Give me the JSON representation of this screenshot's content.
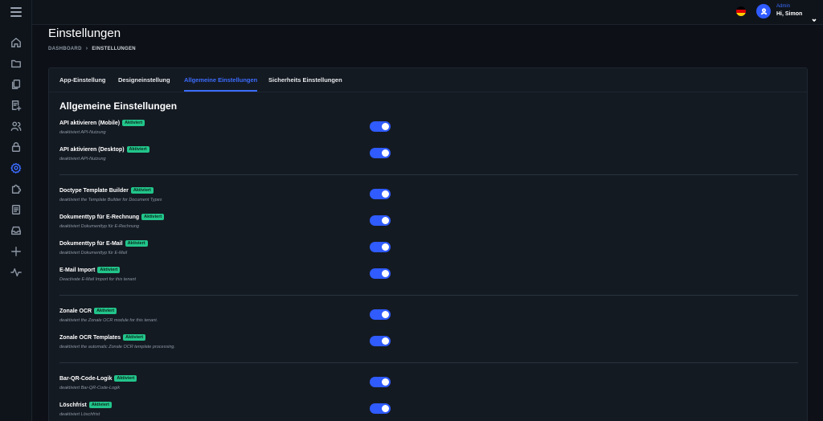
{
  "header": {
    "flag": "germany-flag",
    "user_role": "Admin",
    "user_greeting": "Hi, Simon"
  },
  "sidebar": {
    "items": [
      {
        "icon": "home-icon"
      },
      {
        "icon": "folder-icon"
      },
      {
        "icon": "documents-icon"
      },
      {
        "icon": "document-add-icon"
      },
      {
        "icon": "users-icon"
      },
      {
        "icon": "lock-icon"
      },
      {
        "icon": "gear-icon",
        "active": true
      },
      {
        "icon": "puzzle-icon"
      },
      {
        "icon": "report-icon"
      },
      {
        "icon": "inbox-icon"
      },
      {
        "icon": "plus-icon"
      },
      {
        "icon": "activity-icon"
      }
    ]
  },
  "page": {
    "title": "Einstellungen",
    "breadcrumb": {
      "root": "DASHBOARD",
      "separator": "›",
      "current": "EINSTELLUNGEN"
    }
  },
  "tabs": [
    {
      "label": "App-Einstellung"
    },
    {
      "label": "Designeinstellung"
    },
    {
      "label": "Allgemeine Einstellungen",
      "active": true
    },
    {
      "label": "Sicherheits Einstellungen"
    }
  ],
  "section": {
    "title": "Allgemeine Einstellungen"
  },
  "badge_label": "Aktiviert",
  "settings": [
    {
      "label": "API aktivieren (Mobile)",
      "description": "deaktiviert API-Nutzung",
      "enabled": true
    },
    {
      "label": "API aktivieren (Desktop)",
      "description": "deaktiviert API-Nutzung",
      "enabled": true
    },
    {
      "label": "Doctype Template Builder",
      "description": "deaktiviert the Template Builder for Document Types",
      "enabled": true
    },
    {
      "label": "Dokumenttyp für E-Rechnung",
      "description": "deaktiviert Dokumenttyp für E-Rechnung",
      "enabled": true
    },
    {
      "label": "Dokumenttyp für E-Mail",
      "description": "deaktiviert Dokumenttyp für E-Mail",
      "enabled": true
    },
    {
      "label": "E-Mail Import",
      "description": "Deactivate E-Mail Import for this tenant",
      "enabled": true
    },
    {
      "label": "Zonale OCR",
      "description": "deaktiviert the Zonale OCR module for this tenant.",
      "enabled": true
    },
    {
      "label": "Zonale OCR Templates",
      "description": "deaktiviert the automatic Zonale OCR template processing.",
      "enabled": true
    },
    {
      "label": "Bar-QR-Code-Logik",
      "description": "deaktiviert Bar-QR-Code-Logik",
      "enabled": true
    },
    {
      "label": "Löschfrist",
      "description": "deaktiviert Löschfrist",
      "enabled": true
    }
  ]
}
